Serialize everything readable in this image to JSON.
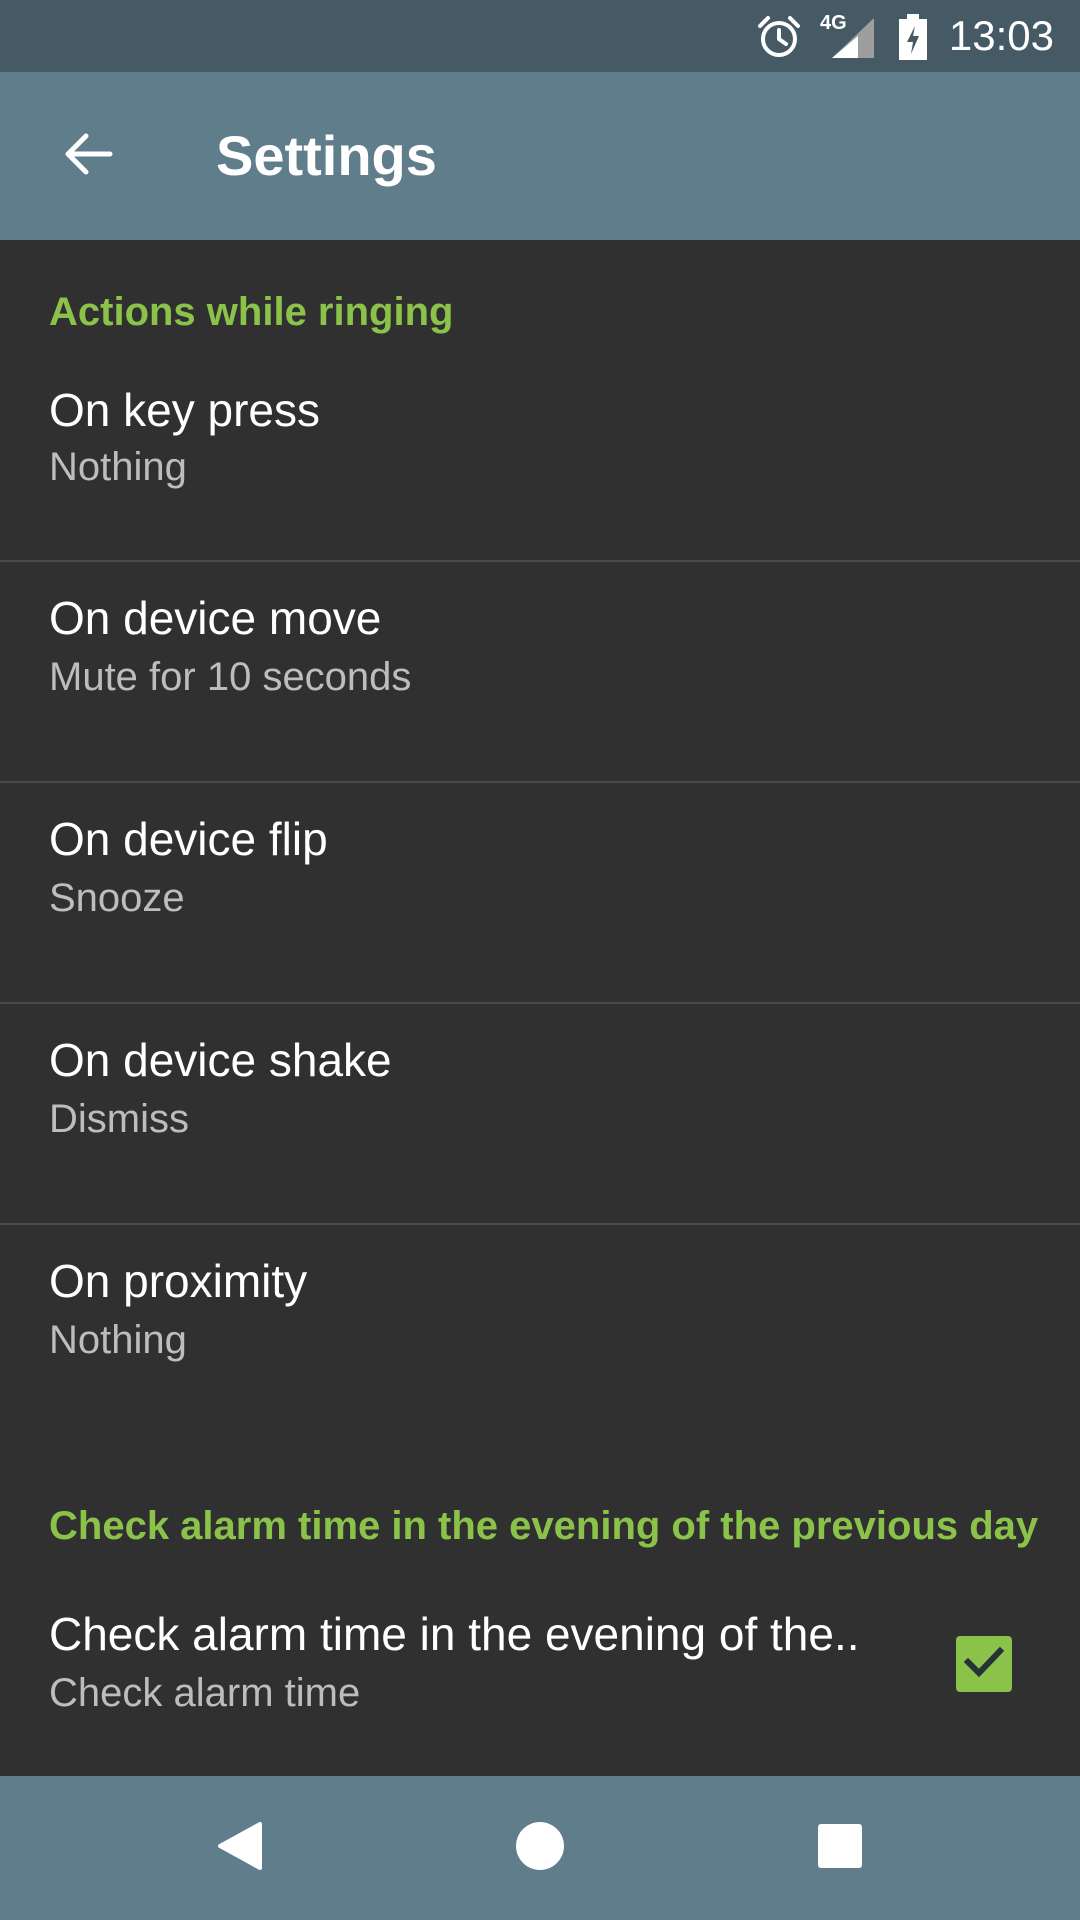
{
  "status_bar": {
    "time": "13:03",
    "network": "4G",
    "icons": [
      "alarm-clock-icon",
      "cellular-signal-icon",
      "battery-charging-icon"
    ]
  },
  "app_bar": {
    "title": "Settings",
    "back_icon": "arrow-back-icon"
  },
  "sections": [
    {
      "header": "Actions while ringing",
      "items": [
        {
          "title": "On key press",
          "summary": "Nothing"
        },
        {
          "title": "On device move",
          "summary": "Mute for 10 seconds"
        },
        {
          "title": "On device flip",
          "summary": "Snooze"
        },
        {
          "title": "On device shake",
          "summary": "Dismiss"
        },
        {
          "title": "On proximity",
          "summary": "Nothing"
        }
      ]
    },
    {
      "header": "Check alarm time in the evening of the previous day",
      "items": [
        {
          "title": "Check alarm time in the evening of the..",
          "summary": "Check alarm time",
          "checked": true
        }
      ]
    }
  ],
  "nav_bar": {
    "buttons": [
      "back-nav-icon",
      "home-nav-icon",
      "recents-nav-icon"
    ]
  },
  "colors": {
    "status_bar": "#455a64",
    "app_bar": "#607d8b",
    "background": "#303030",
    "accent": "#8bc34a",
    "text_primary": "#ffffff",
    "text_secondary": "#bdbdbd"
  }
}
